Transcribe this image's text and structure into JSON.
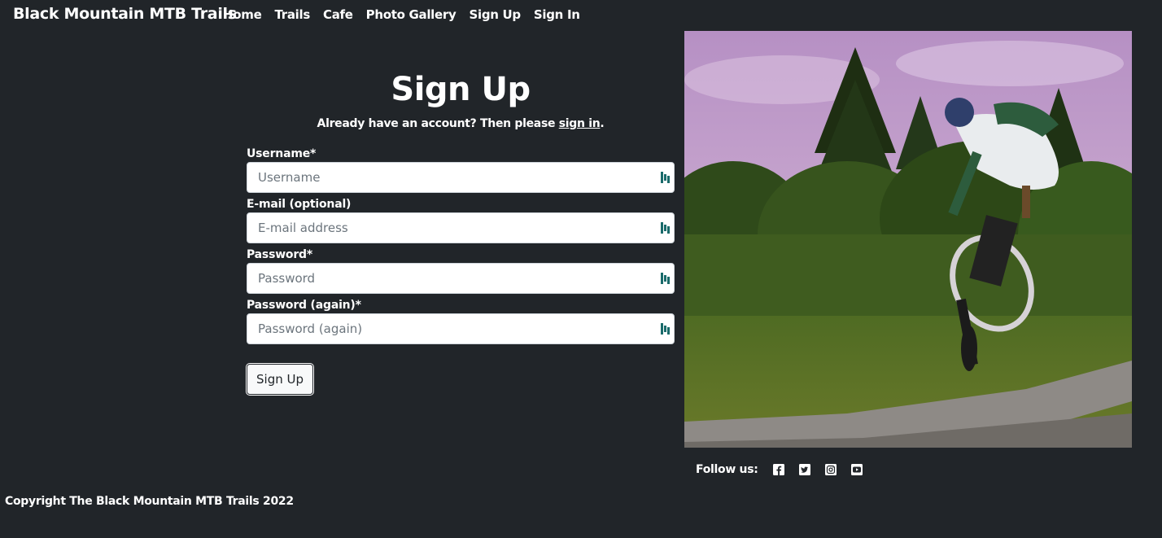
{
  "navbar": {
    "brand": "Black Mountain MTB Trails",
    "links": [
      "Home",
      "Trails",
      "Cafe",
      "Photo Gallery",
      "Sign Up",
      "Sign In"
    ]
  },
  "signup": {
    "title": "Sign Up",
    "prompt_prefix": "Already have an account? Then please ",
    "prompt_link": "sign in",
    "prompt_suffix": ".",
    "fields": [
      {
        "label": "Username*",
        "placeholder": "Username",
        "value": ""
      },
      {
        "label": "E-mail (optional)",
        "placeholder": "E-mail address",
        "value": ""
      },
      {
        "label": "Password*",
        "placeholder": "Password",
        "value": ""
      },
      {
        "label": "Password (again)*",
        "placeholder": "Password (again)",
        "value": ""
      }
    ],
    "submit_label": "Sign Up",
    "field_icon": "password-manager-icon"
  },
  "hero": {
    "subject": "mountain-biker-jump-photo"
  },
  "social": {
    "label": "Follow us:",
    "icons": [
      "facebook-icon",
      "twitter-icon",
      "instagram-icon",
      "youtube-icon"
    ]
  },
  "footer": {
    "copyright": "Copyright The Black Mountain MTB Trails 2022"
  },
  "colors": {
    "background": "#212529",
    "text": "#ffffff",
    "icon_accent": "#1a6b6b"
  }
}
